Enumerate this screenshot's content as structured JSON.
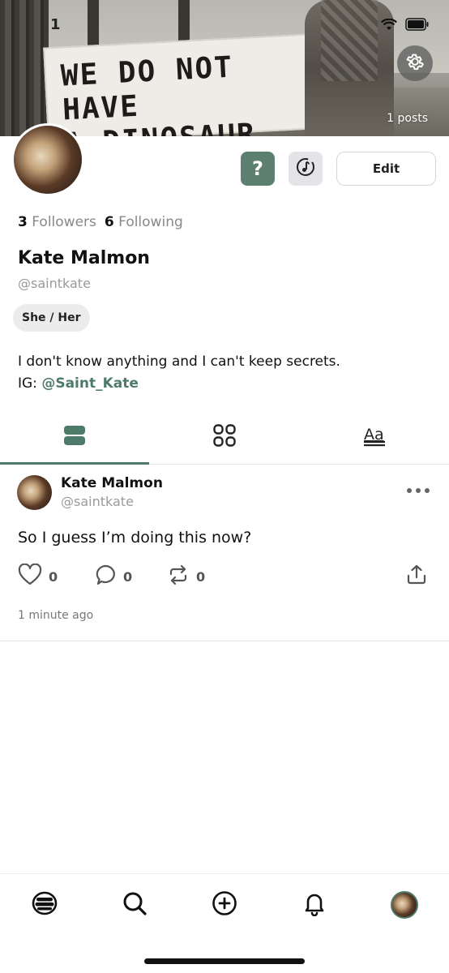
{
  "status_bar": {
    "time": "1"
  },
  "header": {
    "sign_line1": "WE DO NOT HAVE",
    "sign_line2": "A DINOSAUR",
    "posts_count": "1 posts"
  },
  "actions": {
    "question_label": "?",
    "edit_label": "Edit"
  },
  "profile": {
    "followers_count": "3",
    "followers_label": "Followers",
    "following_count": "6",
    "following_label": "Following",
    "name": "Kate Malmon",
    "handle": "@saintkate",
    "pronouns": "She / Her",
    "bio_line1": "I don't know anything and I can't keep secrets.",
    "bio_ig_prefix": "IG: ",
    "bio_ig_handle": "@Saint_Kate"
  },
  "tabs": [
    {
      "name": "posts-list",
      "icon": "list-icon",
      "active": true
    },
    {
      "name": "grid",
      "icon": "grid-icon",
      "active": false
    },
    {
      "name": "text",
      "icon": "text-format-icon",
      "active": false
    }
  ],
  "post": {
    "author_name": "Kate Malmon",
    "author_handle": "@saintkate",
    "text": "So I guess I’m doing this now?",
    "likes": "0",
    "comments": "0",
    "reposts": "0",
    "time_ago": "1 minute ago"
  },
  "bottom_nav": [
    "home-icon",
    "search-icon",
    "add-icon",
    "notifications-icon",
    "profile-avatar"
  ],
  "colors": {
    "accent": "#4e7a6a",
    "question_button": "#5c7f70"
  }
}
